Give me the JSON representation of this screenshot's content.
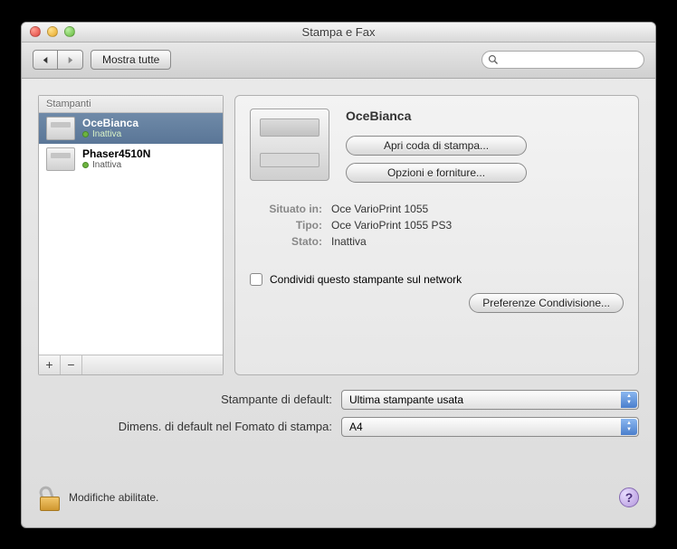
{
  "window": {
    "title": "Stampa e Fax"
  },
  "toolbar": {
    "show_all_label": "Mostra tutte",
    "search_placeholder": ""
  },
  "sidebar": {
    "header": "Stampanti",
    "printers": [
      {
        "name": "OceBianca",
        "status": "Inattiva"
      },
      {
        "name": "Phaser4510N",
        "status": "Inattiva"
      }
    ]
  },
  "detail": {
    "title": "OceBianca",
    "open_queue_label": "Apri coda di stampa...",
    "options_supplies_label": "Opzioni e forniture...",
    "location_label": "Situato in:",
    "location_value": "Oce VarioPrint 1055",
    "kind_label": "Tipo:",
    "kind_value": "Oce VarioPrint 1055 PS3",
    "status_label": "Stato:",
    "status_value": "Inattiva",
    "share_label": "Condividi questo stampante sul network",
    "share_prefs_label": "Preferenze Condivisione..."
  },
  "dropdowns": {
    "default_printer_label": "Stampante di default:",
    "default_printer_value": "Ultima stampante usata",
    "paper_size_label": "Dimens. di default nel Fomato di stampa:",
    "paper_size_value": "A4"
  },
  "footer": {
    "lock_text": "Modifiche abilitate."
  }
}
